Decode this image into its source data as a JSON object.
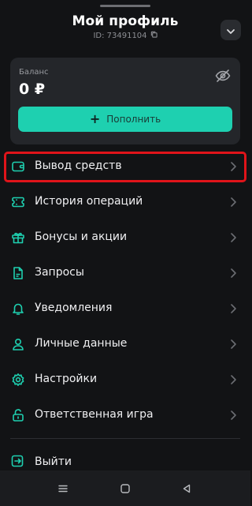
{
  "header": {
    "title": "Мой профиль",
    "user_id": "ID: 73491104"
  },
  "balance": {
    "label": "Баланс",
    "value": "0 ₽",
    "topup_label": "Пополнить"
  },
  "menu": {
    "items": [
      {
        "label": "Вывод средств",
        "icon": "wallet-icon"
      },
      {
        "label": "История операций",
        "icon": "ticket-icon"
      },
      {
        "label": "Бонусы и акции",
        "icon": "gift-icon"
      },
      {
        "label": "Запросы",
        "icon": "document-icon"
      },
      {
        "label": "Уведомления",
        "icon": "bell-icon"
      },
      {
        "label": "Личные данные",
        "icon": "user-icon"
      },
      {
        "label": "Настройки",
        "icon": "gear-icon"
      },
      {
        "label": "Ответственная игра",
        "icon": "lock-icon"
      }
    ],
    "highlighted_item": "Вывод средств"
  },
  "logout": {
    "label": "Выйти",
    "icon": "logout-icon"
  },
  "colors": {
    "background": "#121315",
    "card": "#24262a",
    "accent": "#1ed0b0",
    "icon": "#1ed0b0",
    "highlight": "#e0141a"
  },
  "navbar": {
    "buttons": [
      "menu-icon",
      "home-icon",
      "back-icon"
    ]
  }
}
